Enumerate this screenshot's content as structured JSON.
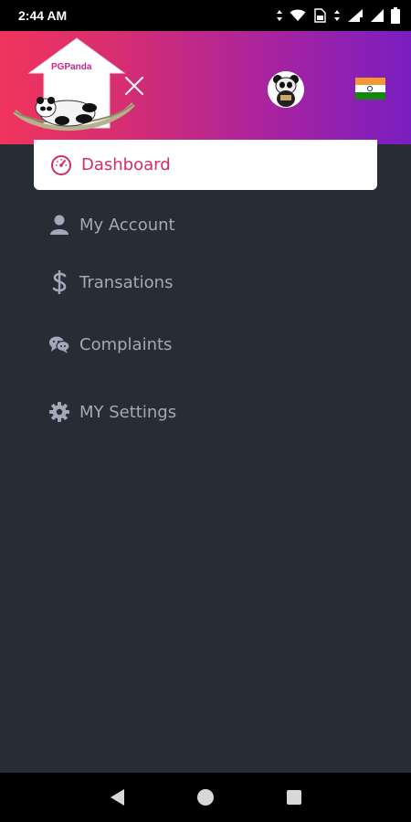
{
  "status_bar": {
    "time": "2:44 AM",
    "icons": [
      "data-arrows-icon",
      "wifi-icon",
      "sim-icon",
      "signal-icon",
      "signal-icon",
      "battery-icon"
    ]
  },
  "header": {
    "logo": {
      "brand_pg": "PG",
      "brand_name": "Panda"
    },
    "close_icon": "close-icon",
    "avatar_icon": "panda-avatar",
    "flag": "india-flag-icon"
  },
  "menu": {
    "active": {
      "label": "Dashboard",
      "icon": "speedometer-icon",
      "color": "#d42c63"
    },
    "items": [
      {
        "label": "My Account",
        "icon": "user-icon"
      },
      {
        "label": "Transations",
        "icon": "dollar-icon"
      },
      {
        "label": "Complaints",
        "icon": "chat-icon"
      },
      {
        "label": "MY Settings",
        "icon": "gear-icon"
      }
    ]
  },
  "colors": {
    "background": "#282c35",
    "header_gradient_start": "#f0355c",
    "header_gradient_end": "#7a1ec0",
    "menu_text": "#a4a8b8"
  },
  "nav_bar": {
    "icons": [
      "back-icon",
      "home-icon",
      "recents-icon"
    ]
  }
}
